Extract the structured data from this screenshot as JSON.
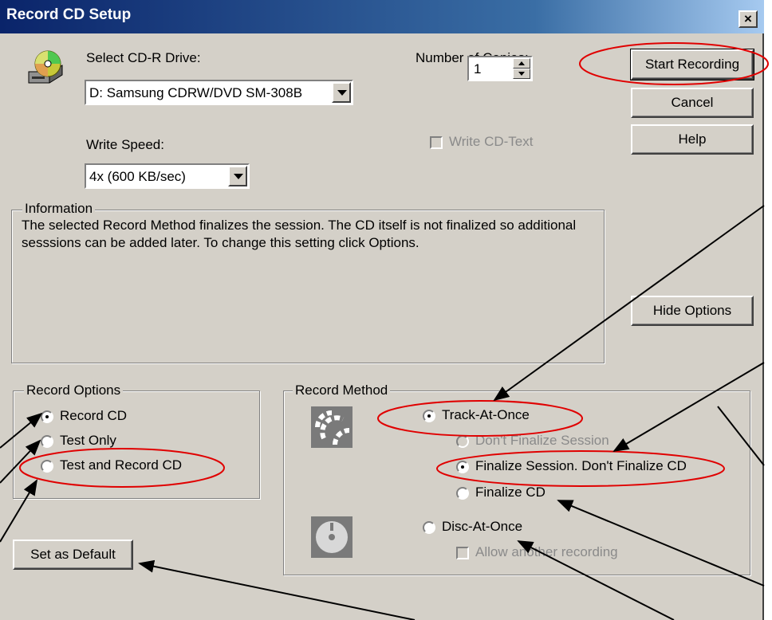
{
  "window": {
    "title": "Record CD Setup",
    "close_glyph": "×"
  },
  "drive": {
    "label": "Select CD-R Drive:",
    "value": "D: Samsung CDRW/DVD SM-308B"
  },
  "speed": {
    "label": "Write Speed:",
    "value": "4x (600 KB/sec)"
  },
  "copies": {
    "label": "Number of Copies:",
    "value": "1"
  },
  "cdtext": {
    "label": "Write CD-Text",
    "checked": false,
    "disabled": true
  },
  "buttons": {
    "start": "Start Recording",
    "cancel": "Cancel",
    "help": "Help",
    "hide_options": "Hide Options",
    "set_default": "Set as Default"
  },
  "information": {
    "legend": "Information",
    "text": "The selected Record Method finalizes the session. The CD itself is not finalized so additional sesssions can be added later. To change this setting click Options."
  },
  "record_options": {
    "legend": "Record Options",
    "items": [
      {
        "label": "Record CD",
        "checked": true
      },
      {
        "label": "Test Only",
        "checked": false
      },
      {
        "label": "Test and Record CD",
        "checked": false
      }
    ]
  },
  "record_method": {
    "legend": "Record Method",
    "track_at_once": "Track-At-Once",
    "dont_finalize_session": "Don't Finalize Session",
    "finalize_session": "Finalize Session. Don't Finalize CD",
    "finalize_cd": "Finalize CD",
    "disc_at_once": "Disc-At-Once",
    "allow_another": "Allow another recording"
  },
  "icons": {
    "cd_drive": "cd-drive-icon",
    "track_at_once": "track-at-once-icon",
    "disc_at_once": "disc-at-once-icon"
  },
  "colors": {
    "title_gradient_start": "#0a246a",
    "face": "#d4d0c8",
    "annotation_red": "#e00000"
  }
}
